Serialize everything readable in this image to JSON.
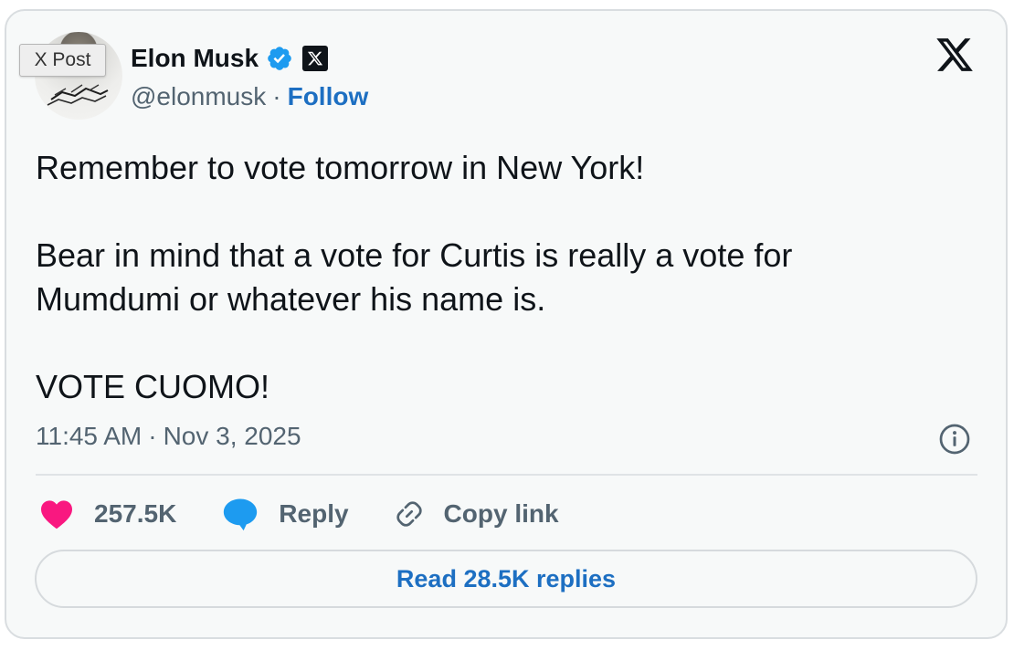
{
  "badge": {
    "label": "X Post"
  },
  "author": {
    "name": "Elon Musk",
    "handle": "@elonmusk",
    "separator": "·",
    "follow_label": "Follow"
  },
  "tweet": {
    "lines": [
      "Remember to vote tomorrow in New York!",
      "Bear in mind that a vote for Curtis is really a vote for\nMumdumi or whatever his name is.",
      "VOTE CUOMO!"
    ],
    "time": "11:45 AM",
    "separator": "·",
    "date": "Nov 3, 2025"
  },
  "actions": {
    "like_count": "257.5K",
    "reply_label": "Reply",
    "copy_link_label": "Copy link"
  },
  "read_replies_label": "Read 28.5K replies",
  "icons": {
    "x_logo": "x-logo-icon",
    "verified": "verified-badge-icon",
    "x_affiliate": "x-affiliate-icon",
    "info": "info-icon",
    "like": "heart-icon",
    "reply": "speech-bubble-icon",
    "copy": "link-icon"
  },
  "colors": {
    "accent": "#1d6fc2",
    "like": "#f91880",
    "reply": "#1d9bf0",
    "verified": "#1d9bf0",
    "muted": "#536471",
    "text": "#0f1419"
  }
}
